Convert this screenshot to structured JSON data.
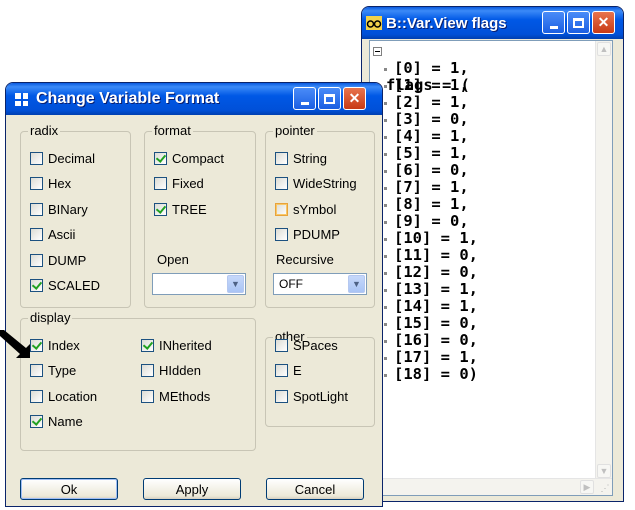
{
  "varview": {
    "title": "B::Var.View flags",
    "header": "flags = (",
    "entries": [
      "[0] = 1,",
      "[1] = 1,",
      "[2] = 1,",
      "[3] = 0,",
      "[4] = 1,",
      "[5] = 1,",
      "[6] = 0,",
      "[7] = 1,",
      "[8] = 1,",
      "[9] = 0,",
      "[10] = 1,",
      "[11] = 0,",
      "[12] = 0,",
      "[13] = 1,",
      "[14] = 1,",
      "[15] = 0,",
      "[16] = 0,",
      "[17] = 1,",
      "[18] = 0)"
    ]
  },
  "dialog": {
    "title": "Change Variable Format",
    "radix": {
      "label": "radix",
      "items": [
        {
          "label": "Decimal",
          "checked": false
        },
        {
          "label": "Hex",
          "checked": false
        },
        {
          "label": "BINary",
          "checked": false
        },
        {
          "label": "Ascii",
          "checked": false
        },
        {
          "label": "DUMP",
          "checked": false
        },
        {
          "label": "SCALED",
          "checked": true
        }
      ]
    },
    "format": {
      "label": "format",
      "items": [
        {
          "label": "Compact",
          "checked": true
        },
        {
          "label": "Fixed",
          "checked": false
        },
        {
          "label": "TREE",
          "checked": true
        }
      ]
    },
    "open": {
      "label": "Open",
      "value": ""
    },
    "pointer": {
      "label": "pointer",
      "items": [
        {
          "label": "String",
          "checked": false
        },
        {
          "label": "WideString",
          "checked": false
        },
        {
          "label": "sYmbol",
          "checked": false,
          "focused": true
        },
        {
          "label": "PDUMP",
          "checked": false
        }
      ]
    },
    "recursive": {
      "label": "Recursive",
      "value": "OFF"
    },
    "display": {
      "label": "display",
      "col1": [
        {
          "label": "Index",
          "checked": true
        },
        {
          "label": "Type",
          "checked": false
        },
        {
          "label": "Location",
          "checked": false
        },
        {
          "label": "Name",
          "checked": true
        }
      ],
      "col2": [
        {
          "label": "INherited",
          "checked": true
        },
        {
          "label": "HIdden",
          "checked": false
        },
        {
          "label": "MEthods",
          "checked": false
        }
      ]
    },
    "other": {
      "label": "other",
      "items": [
        {
          "label": "SPaces",
          "checked": false
        },
        {
          "label": "E",
          "checked": false
        },
        {
          "label": "SpotLight",
          "checked": false
        }
      ]
    },
    "buttons": {
      "ok": "Ok",
      "apply": "Apply",
      "cancel": "Cancel"
    }
  },
  "colors": {
    "titlebar": "#0058e6",
    "dialog_bg": "#ece9d8",
    "close_button": "#c83a15",
    "check_mark": "#21a121"
  }
}
